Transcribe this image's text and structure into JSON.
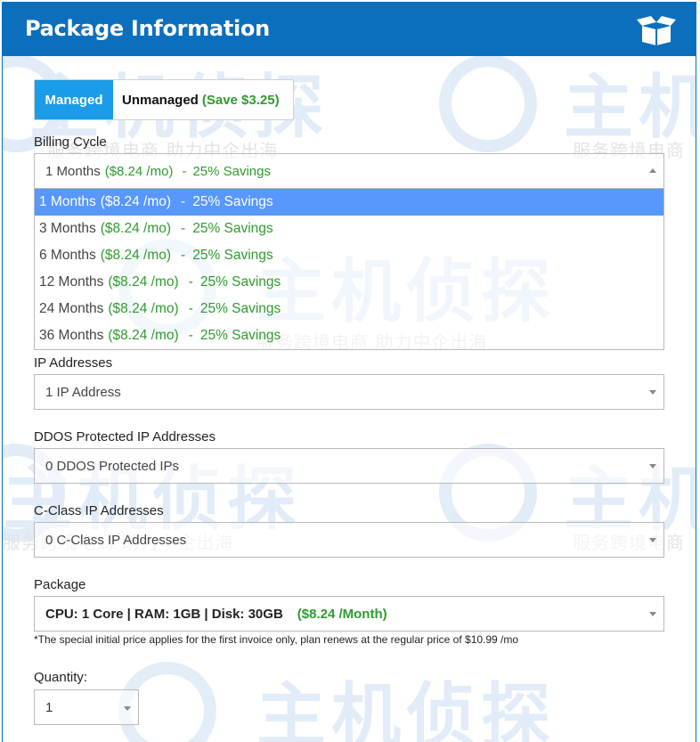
{
  "header": {
    "title": "Package Information",
    "icon": "open-box-icon"
  },
  "watermark": {
    "brand": "主机侦探",
    "tagline_left": "服务跨境电商 助力中企出海",
    "tagline_right": "服务跨境电商"
  },
  "management_toggle": {
    "managed_label": "Managed",
    "unmanaged_label": "Unmanaged",
    "unmanaged_save": "(Save $3.25)",
    "selected": "Managed"
  },
  "billing_cycle": {
    "label": "Billing Cycle",
    "selected": {
      "term": "1 Months",
      "price": "($8.24 /mo)",
      "savings": "25% Savings"
    },
    "options": [
      {
        "term": "1 Months",
        "price": "($8.24 /mo)",
        "savings": "25% Savings"
      },
      {
        "term": "3 Months",
        "price": "($8.24 /mo)",
        "savings": "25% Savings"
      },
      {
        "term": "6 Months",
        "price": "($8.24 /mo)",
        "savings": "25% Savings"
      },
      {
        "term": "12 Months",
        "price": "($8.24 /mo)",
        "savings": "25% Savings"
      },
      {
        "term": "24 Months",
        "price": "($8.24 /mo)",
        "savings": "25% Savings"
      },
      {
        "term": "36 Months",
        "price": "($8.24 /mo)",
        "savings": "25% Savings"
      }
    ],
    "highlighted_index": 0
  },
  "ip_addresses": {
    "label": "IP Addresses",
    "value": "1 IP Address"
  },
  "ddos_ips": {
    "label": "DDOS Protected IP Addresses",
    "value": "0 DDOS Protected IPs"
  },
  "cclass_ips": {
    "label": "C-Class IP Addresses",
    "value": "0 C-Class IP Addresses"
  },
  "package": {
    "label": "Package",
    "value": "CPU: 1 Core | RAM: 1GB | Disk: 30GB",
    "price": "($8.24 /Month)",
    "note": "*The special initial price applies for the first invoice only, plan renews at the regular price of $10.99 /mo"
  },
  "quantity": {
    "label": "Quantity:",
    "value": "1"
  },
  "colors": {
    "header_bg": "#0b6fbd",
    "managed_bg": "#1a9ce8",
    "highlight_bg": "#5897fb",
    "price_green": "#2e9b2e"
  }
}
